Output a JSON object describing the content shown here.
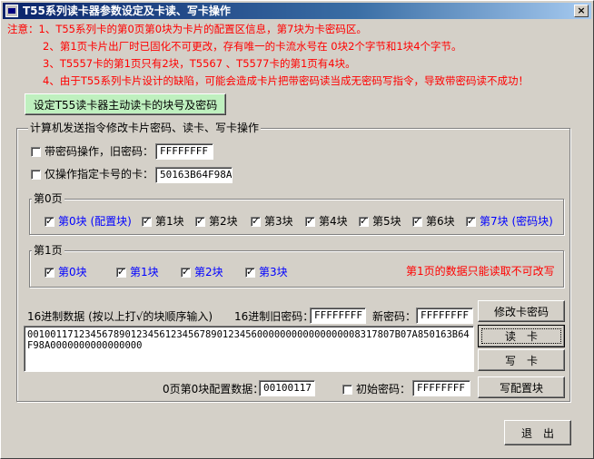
{
  "window": {
    "title": "T55系列读卡器参数设定及卡读、写卡操作",
    "close_label": "×"
  },
  "notes": [
    "注意：1、T55系列卡的第0页第0块为卡片的配置区信息，第7块为卡密码区。",
    "2、第1页卡片出厂时已固化不可更改，存有唯一的卡流水号在 0块2个字节和1块4个字节。",
    "3、T5557卡的第1页只有2块，T5567 、T5577卡的第1页有4块。",
    "4、由于T55系列卡片设计的缺陷，可能会造成卡片把带密码读当成无密码写指令，导致带密码读不成功！"
  ],
  "setup_button": "设定T55读卡器主动读卡的块号及密码",
  "main_group": {
    "label": "计算机发送指令修改卡片密码、读卡、写卡操作",
    "password_op": {
      "label": "带密码操作，旧密码：",
      "value": "FFFFFFFF",
      "checked": false
    },
    "card_only": {
      "label": "仅操作指定卡号的卡：",
      "value": "50163B64F98A",
      "checked": false
    },
    "page0": {
      "label": "第0页",
      "blocks": [
        {
          "label": "第0块 (配置块)",
          "checked": true
        },
        {
          "label": "第1块",
          "checked": true
        },
        {
          "label": "第2块",
          "checked": true
        },
        {
          "label": "第3块",
          "checked": true
        },
        {
          "label": "第4块",
          "checked": true
        },
        {
          "label": "第5块",
          "checked": true
        },
        {
          "label": "第6块",
          "checked": true
        },
        {
          "label": "第7块 (密码块)",
          "checked": true
        }
      ]
    },
    "page1": {
      "label": "第1页",
      "blocks": [
        {
          "label": "第0块",
          "checked": true
        },
        {
          "label": "第1块",
          "checked": true
        },
        {
          "label": "第2块",
          "checked": true
        },
        {
          "label": "第3块",
          "checked": true
        }
      ],
      "note": "第1页的数据只能读取不可改写"
    },
    "hex_data_label": "16进制数据 (按以上打√的块顺序输入)",
    "hex_old_pwd_label": "16进制旧密码：",
    "hex_old_pwd_value": "FFFFFFFF",
    "new_pwd_label": "新密码：",
    "new_pwd_value": "FFFFFFFF",
    "hex_data": "0010011712345678901234561234567890123456000000000000000008317807B07A850163B64F98A0000000000000000",
    "config_label": "0页第0块配置数据：",
    "config_value": "00100117",
    "init_pwd_label": "初始密码：",
    "init_pwd_value": "FFFFFFFF",
    "init_pwd_checked": false
  },
  "buttons": {
    "change_pwd": "修改卡密码",
    "read": "读　卡",
    "write": "写　卡",
    "write_config": "写配置块",
    "exit": "退　出"
  },
  "colors": {
    "face": "#d4d0c8",
    "note_red": "#ff0000",
    "block_blue": "#0000ff",
    "setup_green": "#bff0bf"
  }
}
